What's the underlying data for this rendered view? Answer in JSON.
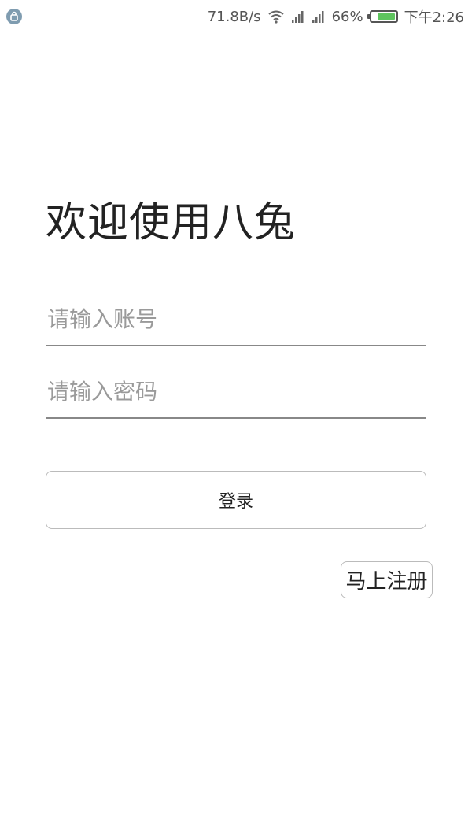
{
  "status_bar": {
    "network_speed": "71.8B/s",
    "battery_percent": "66%",
    "battery_level": 0.66,
    "time": "下午2:26",
    "icons": [
      "app-notification-icon",
      "wifi-icon",
      "signal-icon",
      "signal-icon",
      "battery-icon"
    ]
  },
  "welcome": {
    "title": "欢迎使用八兔"
  },
  "form": {
    "account_placeholder": "请输入账号",
    "password_placeholder": "请输入密码",
    "login_label": "登录",
    "register_label": "马上注册"
  },
  "colors": {
    "battery_fill": "#5ec45e",
    "divider": "#888888"
  }
}
